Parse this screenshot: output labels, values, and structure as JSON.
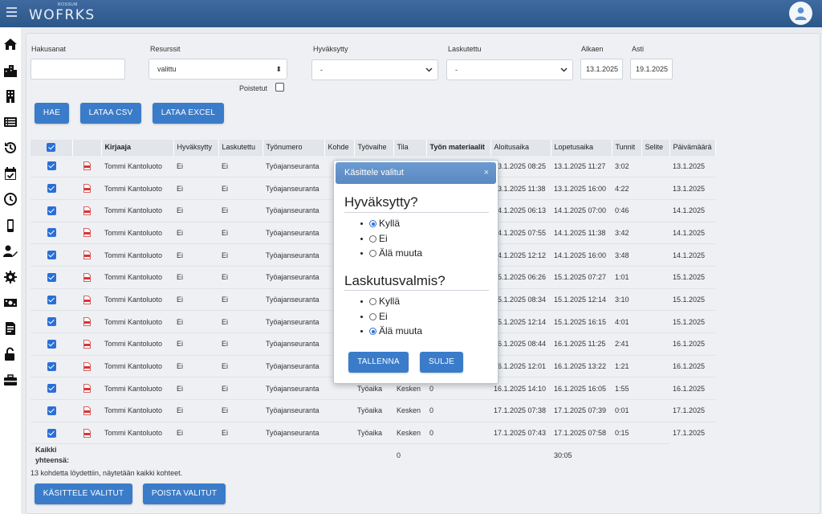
{
  "header": {
    "logo_small": "ROSSUM",
    "logo": "WOFRKS"
  },
  "filters": {
    "hakusanat_label": "Hakusanat",
    "hakusanat_value": "",
    "resurssit_label": "Resurssit",
    "resurssit_value": "valittu",
    "hyvaksytty_label": "Hyväksytty",
    "hyvaksytty_value": "-",
    "laskutettu_label": "Laskutettu",
    "laskutettu_value": "-",
    "alkaen_label": "Alkaen",
    "alkaen_value": "13.1.2025",
    "asti_label": "Asti",
    "asti_value": "19.1.2025",
    "poistetut_label": "Poistetut"
  },
  "actions": {
    "hae": "HAE",
    "csv": "LATAA CSV",
    "excel": "LATAA EXCEL"
  },
  "table": {
    "headers": [
      "Kirjaaja",
      "Hyväksytty",
      "Laskutettu",
      "Työnumero",
      "Kohde",
      "Työvaihe",
      "Tila",
      "Työn materiaalit",
      "Aloitusaika",
      "Lopetusaika",
      "Tunnit",
      "Selite",
      "Päivämäärä"
    ],
    "rows": [
      {
        "kirjaaja": "Tommi Kantoluoto",
        "hyv": "Ei",
        "lask": "Ei",
        "tyonumero": "Työajanseuranta",
        "kohde": "",
        "vaihe": "",
        "tila": "",
        "mat": "",
        "alku": "13.1.2025 08:25",
        "loppu": "13.1.2025 11:27",
        "tunnit": "3:02",
        "selite": "",
        "pvm": "13.1.2025"
      },
      {
        "kirjaaja": "Tommi Kantoluoto",
        "hyv": "Ei",
        "lask": "Ei",
        "tyonumero": "Työajanseuranta",
        "kohde": "",
        "vaihe": "",
        "tila": "",
        "mat": "",
        "alku": "13.1.2025 11:38",
        "loppu": "13.1.2025 16:00",
        "tunnit": "4:22",
        "selite": "",
        "pvm": "13.1.2025"
      },
      {
        "kirjaaja": "Tommi Kantoluoto",
        "hyv": "Ei",
        "lask": "Ei",
        "tyonumero": "Työajanseuranta",
        "kohde": "",
        "vaihe": "",
        "tila": "",
        "mat": "",
        "alku": "14.1.2025 06:13",
        "loppu": "14.1.2025 07:00",
        "tunnit": "0:46",
        "selite": "",
        "pvm": "14.1.2025"
      },
      {
        "kirjaaja": "Tommi Kantoluoto",
        "hyv": "Ei",
        "lask": "Ei",
        "tyonumero": "Työajanseuranta",
        "kohde": "",
        "vaihe": "",
        "tila": "",
        "mat": "",
        "alku": "14.1.2025 07:55",
        "loppu": "14.1.2025 11:38",
        "tunnit": "3:42",
        "selite": "",
        "pvm": "14.1.2025"
      },
      {
        "kirjaaja": "Tommi Kantoluoto",
        "hyv": "Ei",
        "lask": "Ei",
        "tyonumero": "Työajanseuranta",
        "kohde": "",
        "vaihe": "",
        "tila": "",
        "mat": "",
        "alku": "14.1.2025 12:12",
        "loppu": "14.1.2025 16:00",
        "tunnit": "3:48",
        "selite": "",
        "pvm": "14.1.2025"
      },
      {
        "kirjaaja": "Tommi Kantoluoto",
        "hyv": "Ei",
        "lask": "Ei",
        "tyonumero": "Työajanseuranta",
        "kohde": "",
        "vaihe": "",
        "tila": "",
        "mat": "",
        "alku": "15.1.2025 06:26",
        "loppu": "15.1.2025 07:27",
        "tunnit": "1:01",
        "selite": "",
        "pvm": "15.1.2025"
      },
      {
        "kirjaaja": "Tommi Kantoluoto",
        "hyv": "Ei",
        "lask": "Ei",
        "tyonumero": "Työajanseuranta",
        "kohde": "",
        "vaihe": "",
        "tila": "",
        "mat": "",
        "alku": "15.1.2025 08:34",
        "loppu": "15.1.2025 12:14",
        "tunnit": "3:10",
        "selite": "",
        "pvm": "15.1.2025"
      },
      {
        "kirjaaja": "Tommi Kantoluoto",
        "hyv": "Ei",
        "lask": "Ei",
        "tyonumero": "Työajanseuranta",
        "kohde": "",
        "vaihe": "",
        "tila": "",
        "mat": "",
        "alku": "15.1.2025 12:14",
        "loppu": "15.1.2025 16:15",
        "tunnit": "4:01",
        "selite": "",
        "pvm": "15.1.2025"
      },
      {
        "kirjaaja": "Tommi Kantoluoto",
        "hyv": "Ei",
        "lask": "Ei",
        "tyonumero": "Työajanseuranta",
        "kohde": "",
        "vaihe": "",
        "tila": "",
        "mat": "",
        "alku": "16.1.2025 08:44",
        "loppu": "16.1.2025 11:25",
        "tunnit": "2:41",
        "selite": "",
        "pvm": "16.1.2025"
      },
      {
        "kirjaaja": "Tommi Kantoluoto",
        "hyv": "Ei",
        "lask": "Ei",
        "tyonumero": "Työajanseuranta",
        "kohde": "",
        "vaihe": "",
        "tila": "",
        "mat": "",
        "alku": "16.1.2025 12:01",
        "loppu": "16.1.2025 13:22",
        "tunnit": "1:21",
        "selite": "",
        "pvm": "16.1.2025"
      },
      {
        "kirjaaja": "Tommi Kantoluoto",
        "hyv": "Ei",
        "lask": "Ei",
        "tyonumero": "Työajanseuranta",
        "kohde": "",
        "vaihe": "Työaika",
        "tila": "Kesken",
        "mat": "0",
        "alku": "16.1.2025 14:10",
        "loppu": "16.1.2025 16:05",
        "tunnit": "1:55",
        "selite": "",
        "pvm": "16.1.2025"
      },
      {
        "kirjaaja": "Tommi Kantoluoto",
        "hyv": "Ei",
        "lask": "Ei",
        "tyonumero": "Työajanseuranta",
        "kohde": "",
        "vaihe": "Työaika",
        "tila": "Kesken",
        "mat": "0",
        "alku": "17.1.2025 07:38",
        "loppu": "17.1.2025 07:39",
        "tunnit": "0:01",
        "selite": "",
        "pvm": "17.1.2025"
      },
      {
        "kirjaaja": "Tommi Kantoluoto",
        "hyv": "Ei",
        "lask": "Ei",
        "tyonumero": "Työajanseuranta",
        "kohde": "",
        "vaihe": "Työaika",
        "tila": "Kesken",
        "mat": "0",
        "alku": "17.1.2025 07:43",
        "loppu": "17.1.2025 07:58",
        "tunnit": "0:15",
        "selite": "",
        "pvm": "17.1.2025"
      }
    ],
    "summary_label_1": "Kaikki",
    "summary_label_2": "yhteensä:",
    "summary_mat": "0",
    "summary_tunnit": "30:05"
  },
  "footer": {
    "count_text": "13 kohdetta löydettiin, näytetään kaikki kohteet.",
    "process_button": "KÄSITTELE VALITUT",
    "delete_button": "POISTA VALITUT"
  },
  "modal": {
    "title": "Käsittele valitut",
    "close": "×",
    "q1": "Hyväksytty?",
    "q1_options": [
      "Kyllä",
      "Ei",
      "Älä muuta"
    ],
    "q1_selected": 0,
    "q2": "Laskutusvalmis?",
    "q2_options": [
      "Kyllä",
      "Ei",
      "Älä muuta"
    ],
    "q2_selected": 2,
    "save": "TALLENNA",
    "close_button": "SULJE"
  },
  "colors": {
    "header": "#2c5789",
    "button": "#3a7cc9",
    "checkbox": "#2a6fd6",
    "modal_header": "#5a88c0"
  }
}
